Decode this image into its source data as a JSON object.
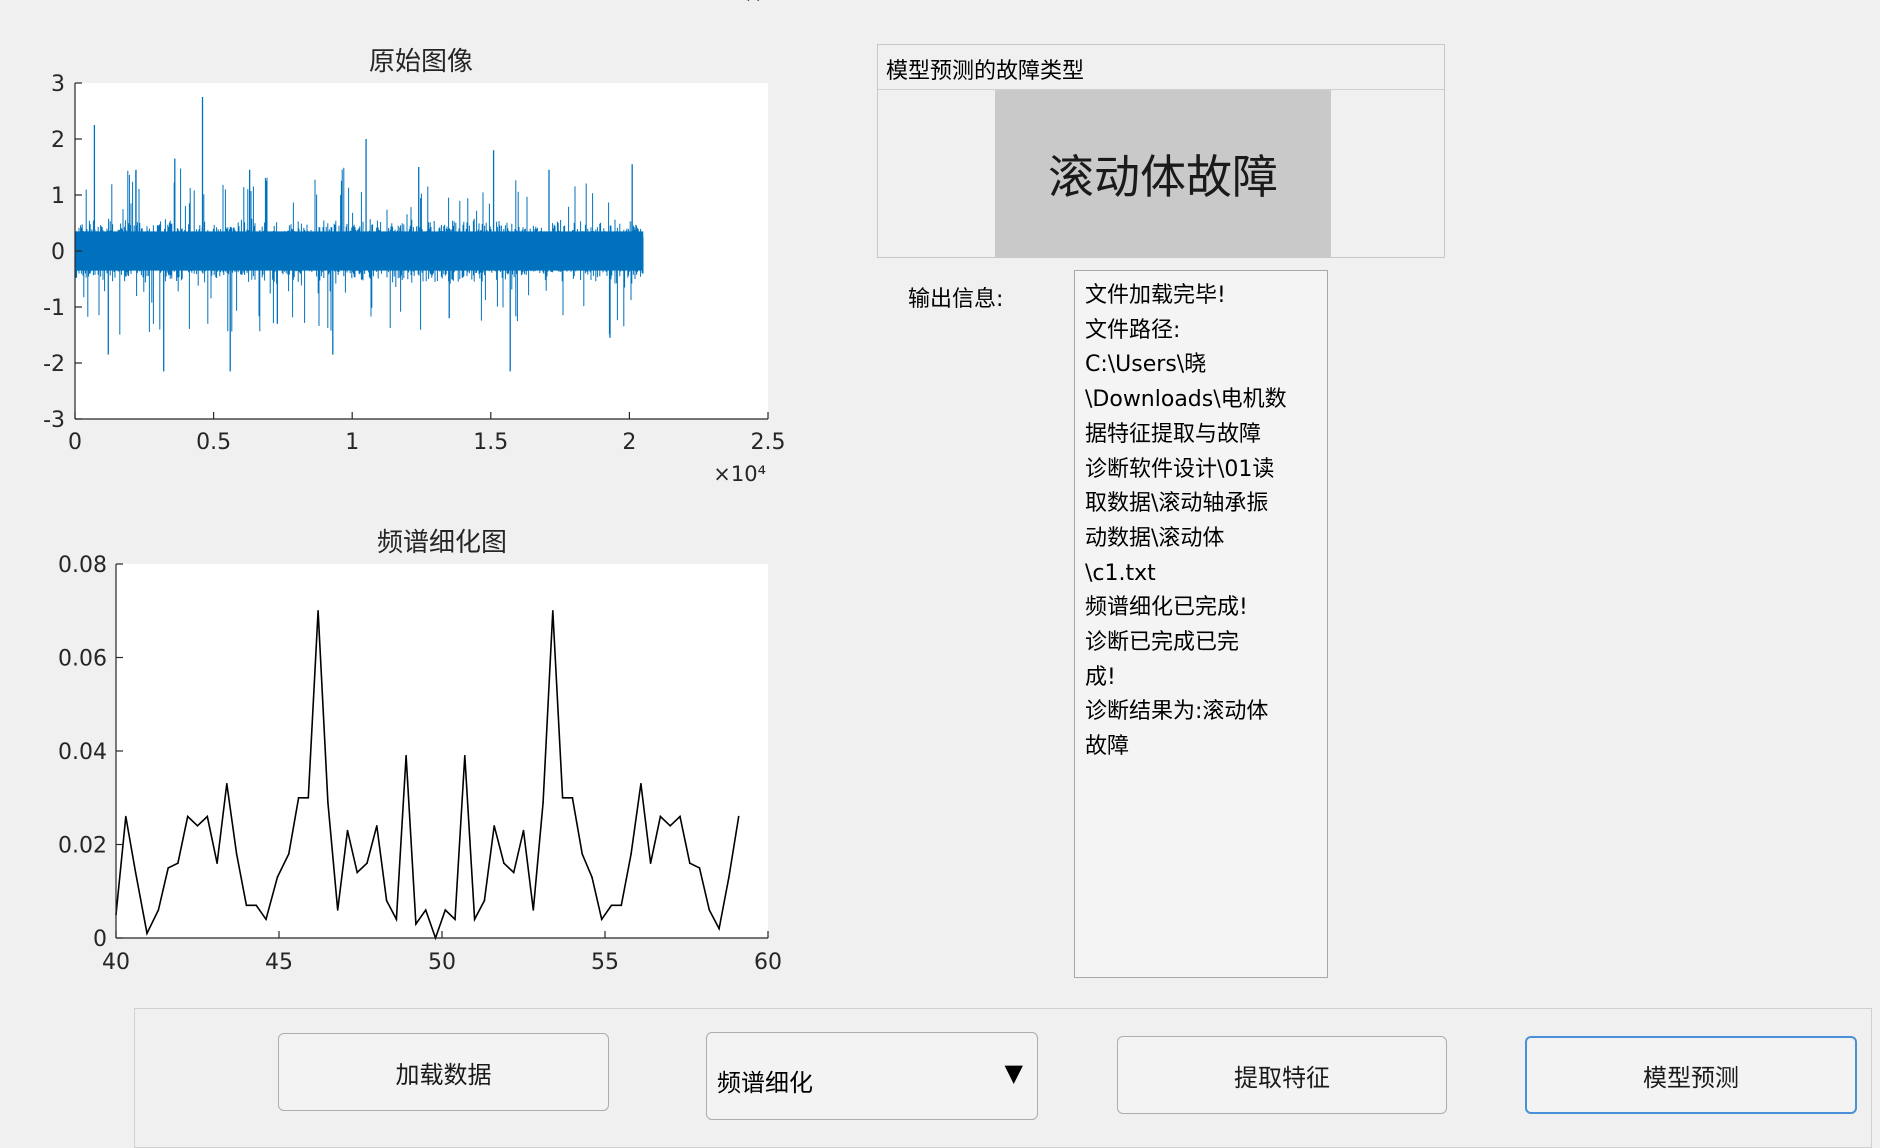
{
  "charts": {
    "raw": {
      "title": "原始图像",
      "x_multiplier_label": "×10⁴"
    },
    "spectrum": {
      "title": "频谱细化图"
    }
  },
  "chart_data": [
    {
      "type": "line",
      "title": "原始图像",
      "x_range": [
        0,
        20500
      ],
      "xlim": [
        0,
        25000
      ],
      "ylim": [
        -3,
        3
      ],
      "x_ticks": [
        0,
        0.5,
        1,
        1.5,
        2,
        2.5
      ],
      "x_tick_labels": [
        "0",
        "0.5",
        "1",
        "1.5",
        "2",
        "2.5"
      ],
      "x_multiplier": "×10⁴",
      "y_ticks": [
        -3,
        -2,
        -1,
        0,
        1,
        2,
        3
      ],
      "y_tick_labels": [
        "-3",
        "-2",
        "-1",
        "0",
        "1",
        "2",
        "3"
      ],
      "color": "#0072bd",
      "envelope_amplitude": 0.6,
      "spikes": [
        {
          "x": 700,
          "y": 2.25
        },
        {
          "x": 4600,
          "y": 2.75
        },
        {
          "x": 10500,
          "y": 2.0
        },
        {
          "x": 15100,
          "y": 1.8
        },
        {
          "x": 3600,
          "y": 1.65
        },
        {
          "x": 1200,
          "y": -1.85
        },
        {
          "x": 3200,
          "y": -2.15
        },
        {
          "x": 5600,
          "y": -2.15
        },
        {
          "x": 9300,
          "y": -1.85
        },
        {
          "x": 15700,
          "y": -2.15
        },
        {
          "x": 19300,
          "y": -1.55
        },
        {
          "x": 7300,
          "y": -1.3
        },
        {
          "x": 2200,
          "y": 1.45
        },
        {
          "x": 6300,
          "y": 1.45
        },
        {
          "x": 12400,
          "y": 1.5
        },
        {
          "x": 17100,
          "y": 1.45
        },
        {
          "x": 20100,
          "y": 1.55
        },
        {
          "x": 13500,
          "y": -1.2
        }
      ]
    },
    {
      "type": "line",
      "title": "频谱细化图",
      "xlim": [
        40,
        60
      ],
      "ylim": [
        0,
        0.08
      ],
      "x_ticks": [
        40,
        45,
        50,
        55,
        60
      ],
      "x_tick_labels": [
        "40",
        "45",
        "50",
        "55",
        "60"
      ],
      "y_ticks": [
        0,
        0.02,
        0.04,
        0.06,
        0.08
      ],
      "y_tick_labels": [
        "0",
        "0.02",
        "0.04",
        "0.06",
        "0.08"
      ],
      "color": "#000000",
      "x": [
        40.0,
        40.3,
        40.6,
        40.95,
        41.3,
        41.6,
        41.9,
        42.2,
        42.5,
        42.8,
        43.1,
        43.4,
        43.7,
        44.0,
        44.3,
        44.6,
        44.95,
        45.3,
        45.6,
        45.9,
        46.2,
        46.5,
        46.8,
        47.1,
        47.4,
        47.7,
        48.0,
        48.3,
        48.6,
        48.9,
        49.2,
        49.5,
        49.8,
        50.1,
        50.4,
        50.7,
        51.0,
        51.3,
        51.6,
        51.9,
        52.2,
        52.5,
        52.8,
        53.1,
        53.4,
        53.7,
        54.0,
        54.3,
        54.6,
        54.9,
        55.2,
        55.5,
        55.8,
        56.1,
        56.4,
        56.7,
        57.0,
        57.3,
        57.6,
        57.9,
        58.2,
        58.5,
        58.8,
        59.1,
        59.4,
        59.7
      ],
      "y": [
        0.005,
        0.026,
        0.014,
        0.001,
        0.006,
        0.015,
        0.016,
        0.026,
        0.024,
        0.026,
        0.016,
        0.033,
        0.018,
        0.007,
        0.007,
        0.004,
        0.013,
        0.018,
        0.03,
        0.03,
        0.07,
        0.029,
        0.006,
        0.023,
        0.014,
        0.016,
        0.024,
        0.008,
        0.004,
        0.039,
        0.003,
        0.006,
        0.0,
        0.006,
        0.004,
        0.039,
        0.004,
        0.008,
        0.024,
        0.016,
        0.014,
        0.023,
        0.006,
        0.029,
        0.07,
        0.03,
        0.03,
        0.018,
        0.013,
        0.004,
        0.007,
        0.007,
        0.018,
        0.033,
        0.016,
        0.026,
        0.024,
        0.026,
        0.016,
        0.015,
        0.006,
        0.002,
        0.013,
        0.026
      ]
    }
  ],
  "result_panel": {
    "title": "模型预测的故障类型",
    "value": "滚动体故障"
  },
  "output": {
    "label": "输出信息:",
    "lines": [
      "文件加载完毕!",
      "文件路径:",
      "C:\\Users\\晓",
      "\\Downloads\\电机数",
      "据特征提取与故障",
      "诊断软件设计\\01读",
      "取数据\\滚动轴承振",
      "动数据\\滚动体",
      "\\c1.txt",
      "频谱细化已完成!",
      "诊断已完成已完",
      "成!",
      "诊断结果为:滚动体",
      "故障"
    ]
  },
  "toolbar": {
    "load_label": "加载数据",
    "dropdown_value": "频谱细化",
    "dropdown_arrow": "▼",
    "extract_label": "提取特征",
    "predict_label": "模型预测"
  }
}
